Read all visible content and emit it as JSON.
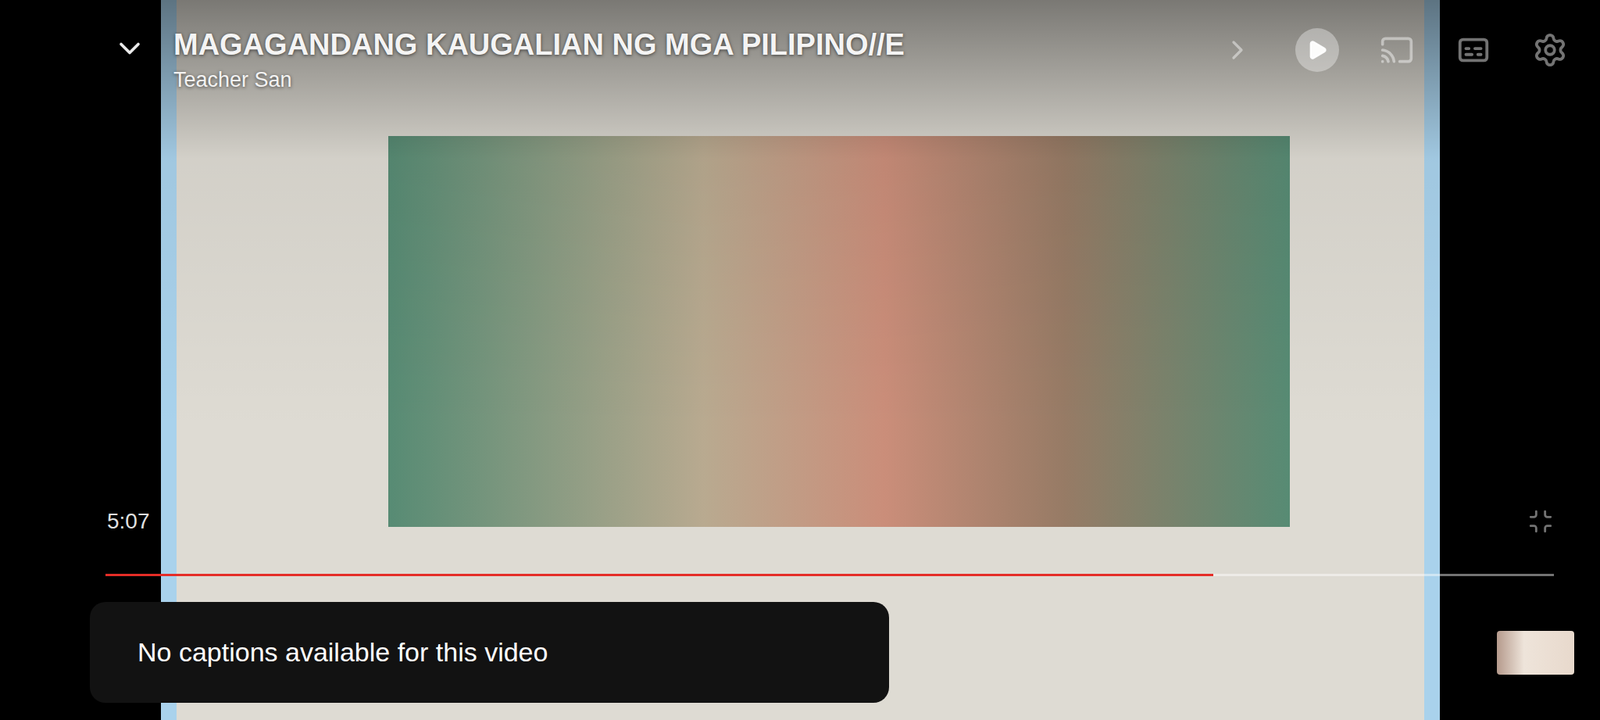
{
  "video": {
    "title": "MAGAGANDANG KAUGALIAN  NG MGA PILIPINO//E",
    "channel": "Teacher San"
  },
  "player": {
    "time": "5:07",
    "playing": false,
    "captions_on": false,
    "progress": {
      "level": 0.765
    }
  },
  "toast": {
    "text": "No captions available for this video"
  }
}
